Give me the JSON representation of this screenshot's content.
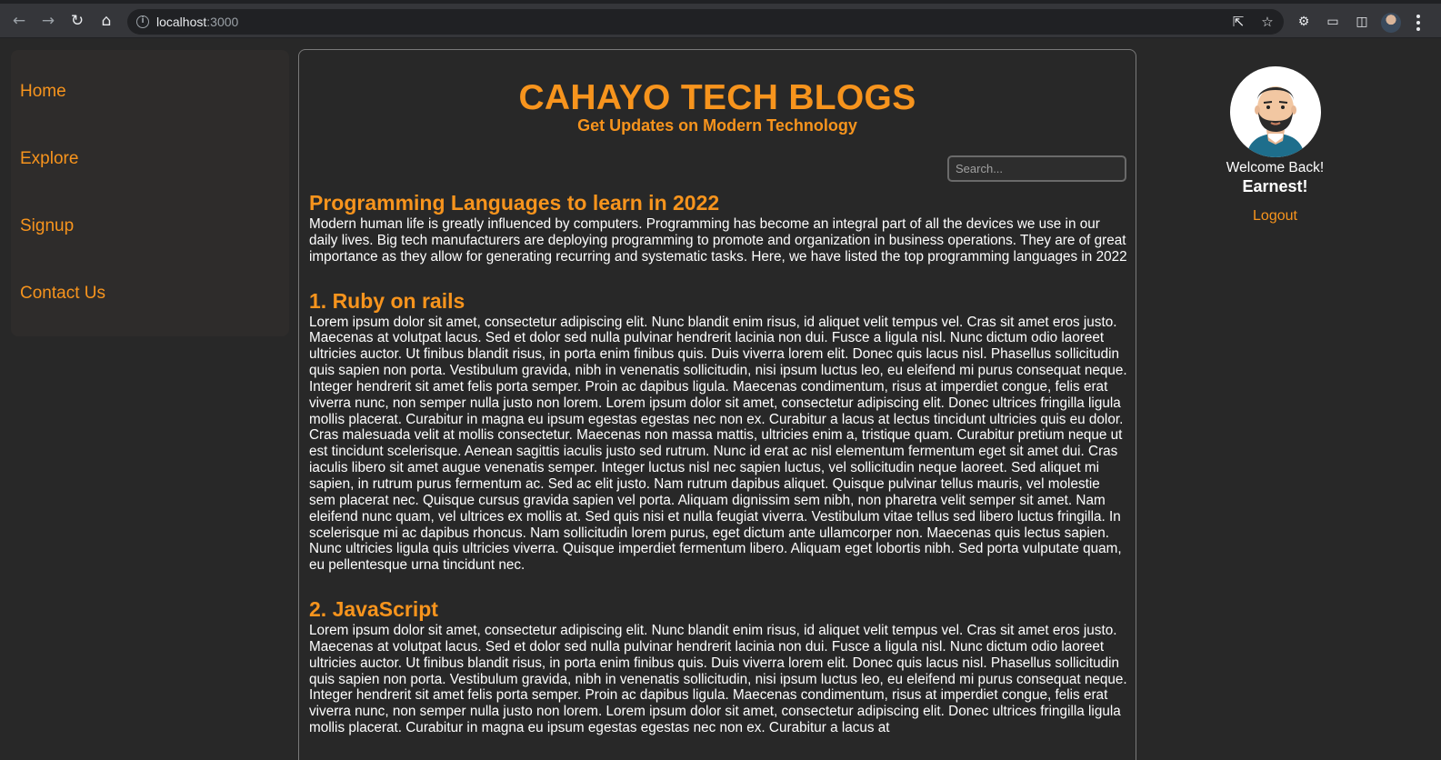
{
  "browser": {
    "url_host": "localhost",
    "url_port": ":3000"
  },
  "sidebar": {
    "items": [
      {
        "label": "Home"
      },
      {
        "label": "Explore"
      },
      {
        "label": "Signup"
      },
      {
        "label": "Contact Us"
      }
    ]
  },
  "header": {
    "title": "CAHAYO TECH BLOGS",
    "subtitle": "Get Updates on Modern Technology"
  },
  "search": {
    "placeholder": "Search..."
  },
  "article": {
    "title": "Programming Languages to learn in 2022",
    "intro": "Modern human life is greatly influenced by computers. Programming has become an integral part of all the devices we use in our daily lives. Big tech manufacturers are deploying programming to promote and organization in business operations. They are of great importance as they allow for generating recurring and systematic tasks. Here, we have listed the top programming languages in 2022",
    "sections": [
      {
        "heading": "1. Ruby on rails",
        "body": "Lorem ipsum dolor sit amet, consectetur adipiscing elit. Nunc blandit enim risus, id aliquet velit tempus vel. Cras sit amet eros justo. Maecenas at volutpat lacus. Sed et dolor sed nulla pulvinar hendrerit lacinia non dui. Fusce a ligula nisl. Nunc dictum odio laoreet ultricies auctor. Ut finibus blandit risus, in porta enim finibus quis. Duis viverra lorem elit. Donec quis lacus nisl. Phasellus sollicitudin quis sapien non porta. Vestibulum gravida, nibh in venenatis sollicitudin, nisi ipsum luctus leo, eu eleifend mi purus consequat neque. Integer hendrerit sit amet felis porta semper. Proin ac dapibus ligula. Maecenas condimentum, risus at imperdiet congue, felis erat viverra nunc, non semper nulla justo non lorem. Lorem ipsum dolor sit amet, consectetur adipiscing elit. Donec ultrices fringilla ligula mollis placerat. Curabitur in magna eu ipsum egestas egestas nec non ex. Curabitur a lacus at lectus tincidunt ultricies quis eu dolor. Cras malesuada velit at mollis consectetur. Maecenas non massa mattis, ultricies enim a, tristique quam. Curabitur pretium neque ut est tincidunt scelerisque. Aenean sagittis iaculis justo sed rutrum. Nunc id erat ac nisl elementum fermentum eget sit amet dui. Cras iaculis libero sit amet augue venenatis semper. Integer luctus nisl nec sapien luctus, vel sollicitudin neque laoreet. Sed aliquet mi sapien, in rutrum purus fermentum ac. Sed ac elit justo. Nam rutrum dapibus aliquet. Quisque pulvinar tellus mauris, vel molestie sem placerat nec. Quisque cursus gravida sapien vel porta. Aliquam dignissim sem nibh, non pharetra velit semper sit amet. Nam eleifend nunc quam, vel ultrices ex mollis at. Sed quis nisi et nulla feugiat viverra. Vestibulum vitae tellus sed libero luctus fringilla. In scelerisque mi ac dapibus rhoncus. Nam sollicitudin lorem purus, eget dictum ante ullamcorper non. Maecenas quis lectus sapien. Nunc ultricies ligula quis ultricies viverra. Quisque imperdiet fermentum libero. Aliquam eget lobortis nibh. Sed porta vulputate quam, eu pellentesque urna tincidunt nec."
      },
      {
        "heading": "2. JavaScript",
        "body": "Lorem ipsum dolor sit amet, consectetur adipiscing elit. Nunc blandit enim risus, id aliquet velit tempus vel. Cras sit amet eros justo. Maecenas at volutpat lacus. Sed et dolor sed nulla pulvinar hendrerit lacinia non dui. Fusce a ligula nisl. Nunc dictum odio laoreet ultricies auctor. Ut finibus blandit risus, in porta enim finibus quis. Duis viverra lorem elit. Donec quis lacus nisl. Phasellus sollicitudin quis sapien non porta. Vestibulum gravida, nibh in venenatis sollicitudin, nisi ipsum luctus leo, eu eleifend mi purus consequat neque. Integer hendrerit sit amet felis porta semper. Proin ac dapibus ligula. Maecenas condimentum, risus at imperdiet congue, felis erat viverra nunc, non semper nulla justo non lorem. Lorem ipsum dolor sit amet, consectetur adipiscing elit. Donec ultrices fringilla ligula mollis placerat. Curabitur in magna eu ipsum egestas egestas nec non ex. Curabitur a lacus at"
      }
    ]
  },
  "user": {
    "welcome": "Welcome Back!",
    "name": "Earnest!",
    "logout_label": "Logout"
  },
  "colors": {
    "accent": "#f7941d",
    "background": "#282828",
    "sidebar": "#2e2c2b"
  }
}
